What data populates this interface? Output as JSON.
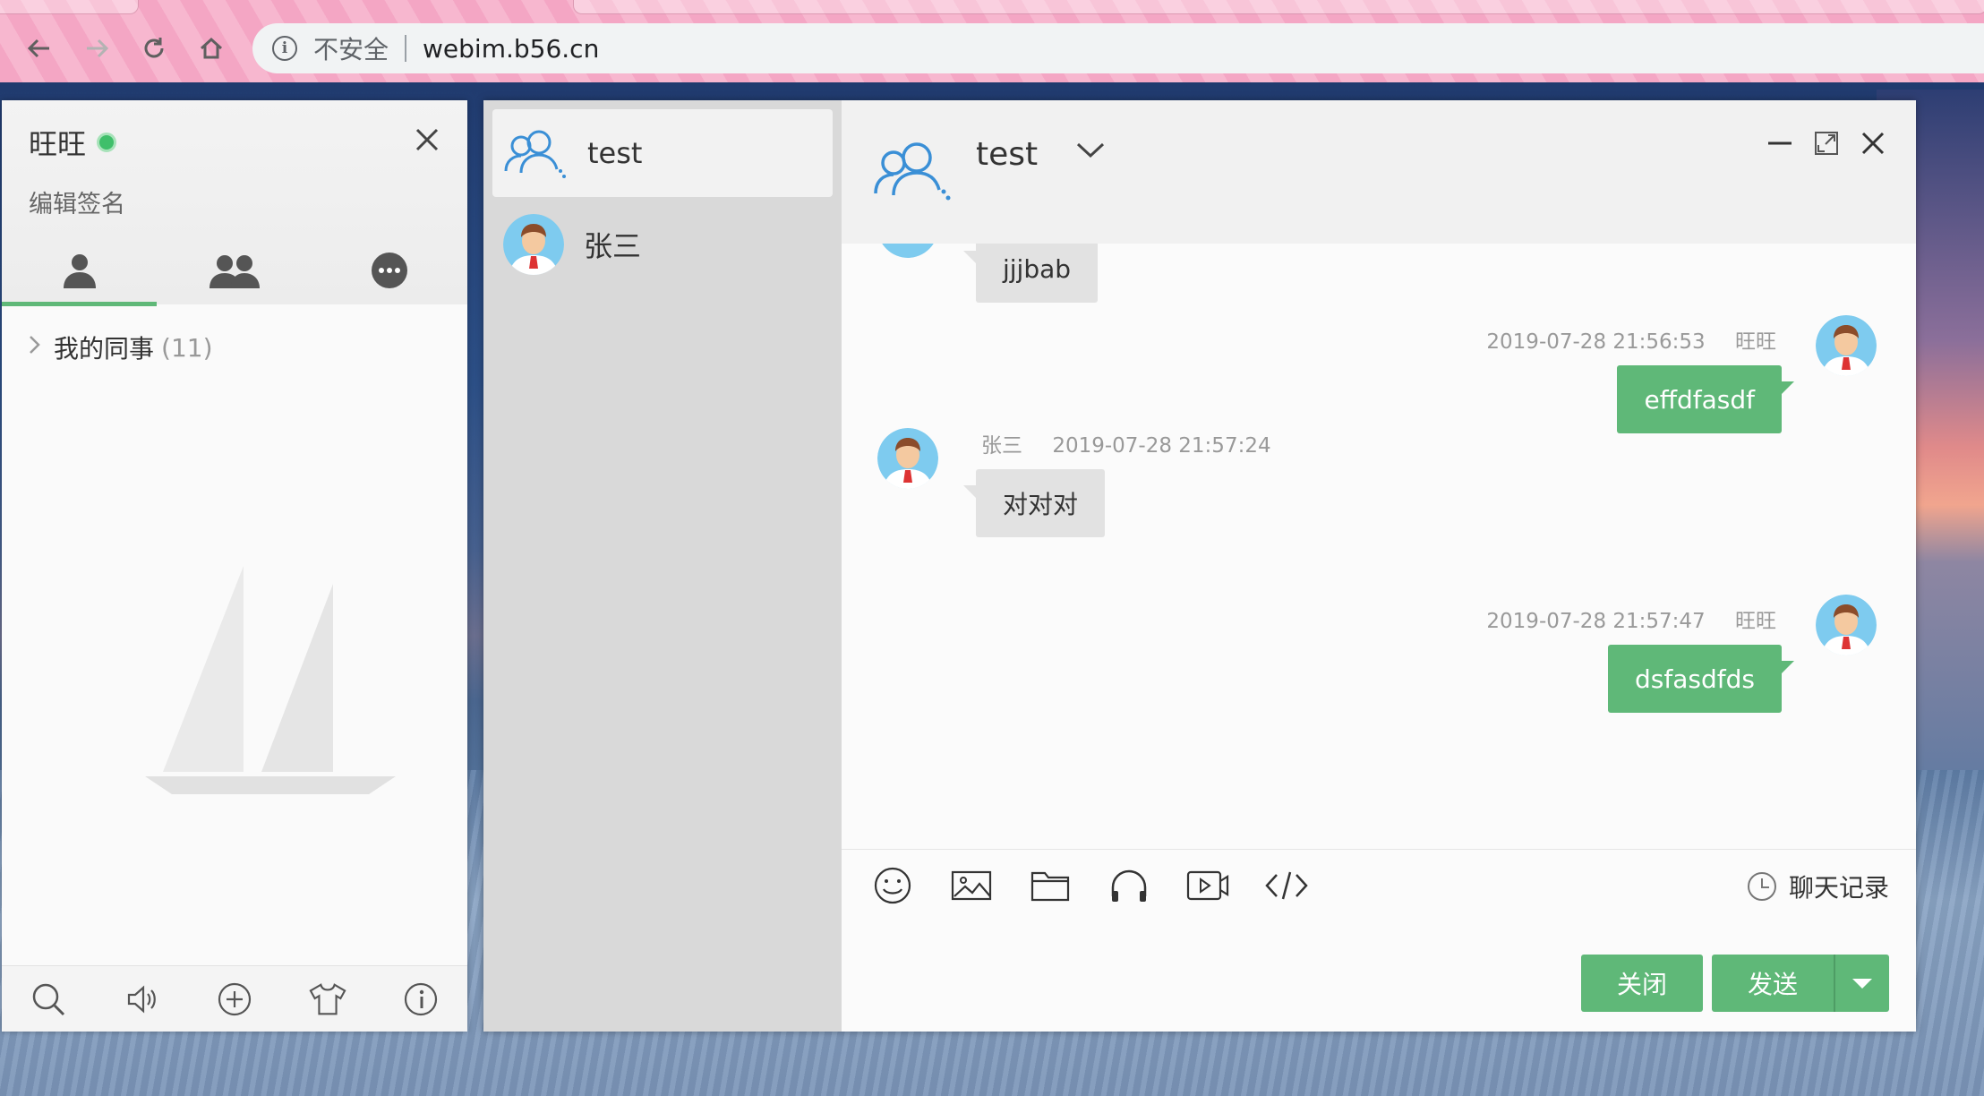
{
  "browser": {
    "insecure_label": "不安全",
    "url": "webim.b56.cn"
  },
  "main_panel": {
    "username": "旺旺",
    "signature": "编辑签名",
    "group": {
      "name": "我的同事",
      "count": "(11)"
    }
  },
  "conversations": [
    {
      "name": "test",
      "type": "group"
    },
    {
      "name": "张三",
      "type": "user"
    }
  ],
  "chat": {
    "title": "test",
    "messages": [
      {
        "side": "left",
        "sender": "",
        "time": "",
        "text": "jjjbab"
      },
      {
        "side": "right",
        "sender": "旺旺",
        "time": "2019-07-28 21:56:53",
        "text": "effdfasdf"
      },
      {
        "side": "left",
        "sender": "张三",
        "time": "2019-07-28 21:57:24",
        "text": "对对对"
      },
      {
        "side": "right",
        "sender": "旺旺",
        "time": "2019-07-28 21:57:47",
        "text": "dsfasdfds"
      }
    ],
    "history_label": "聊天记录",
    "close_label": "关闭",
    "send_label": "发送"
  },
  "colors": {
    "accent_green": "#5fb878",
    "online_dot": "#3fbf6a",
    "group_icon_blue": "#3a8fd6"
  }
}
